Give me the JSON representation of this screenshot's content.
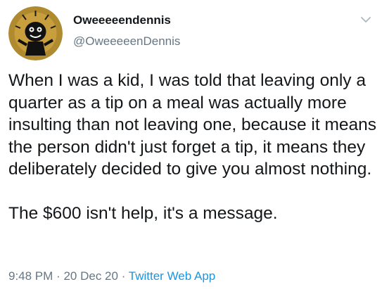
{
  "tweet": {
    "display_name": "Oweeeeendennis",
    "handle": "@OweeeeenDennis",
    "paragraphs": [
      "When I was a kid, I was told that leaving only a quarter as a tip on a meal was actually more insulting than not leaving one, because it means the person didn't just forget a tip, it means they deliberately decided to give you almost nothing.",
      "The $600 isn't help, it's a message."
    ],
    "time": "9:48 PM",
    "separator": "·",
    "date": "20 Dec 20",
    "source": "Twitter Web App",
    "icons": {
      "avatar": "avatar-cartoon-icon",
      "caret": "chevron-down-icon"
    },
    "colors": {
      "text": "#14171a",
      "secondary": "#657786",
      "link": "#1b95e0",
      "avatar_bg": "#b08a2e"
    }
  }
}
